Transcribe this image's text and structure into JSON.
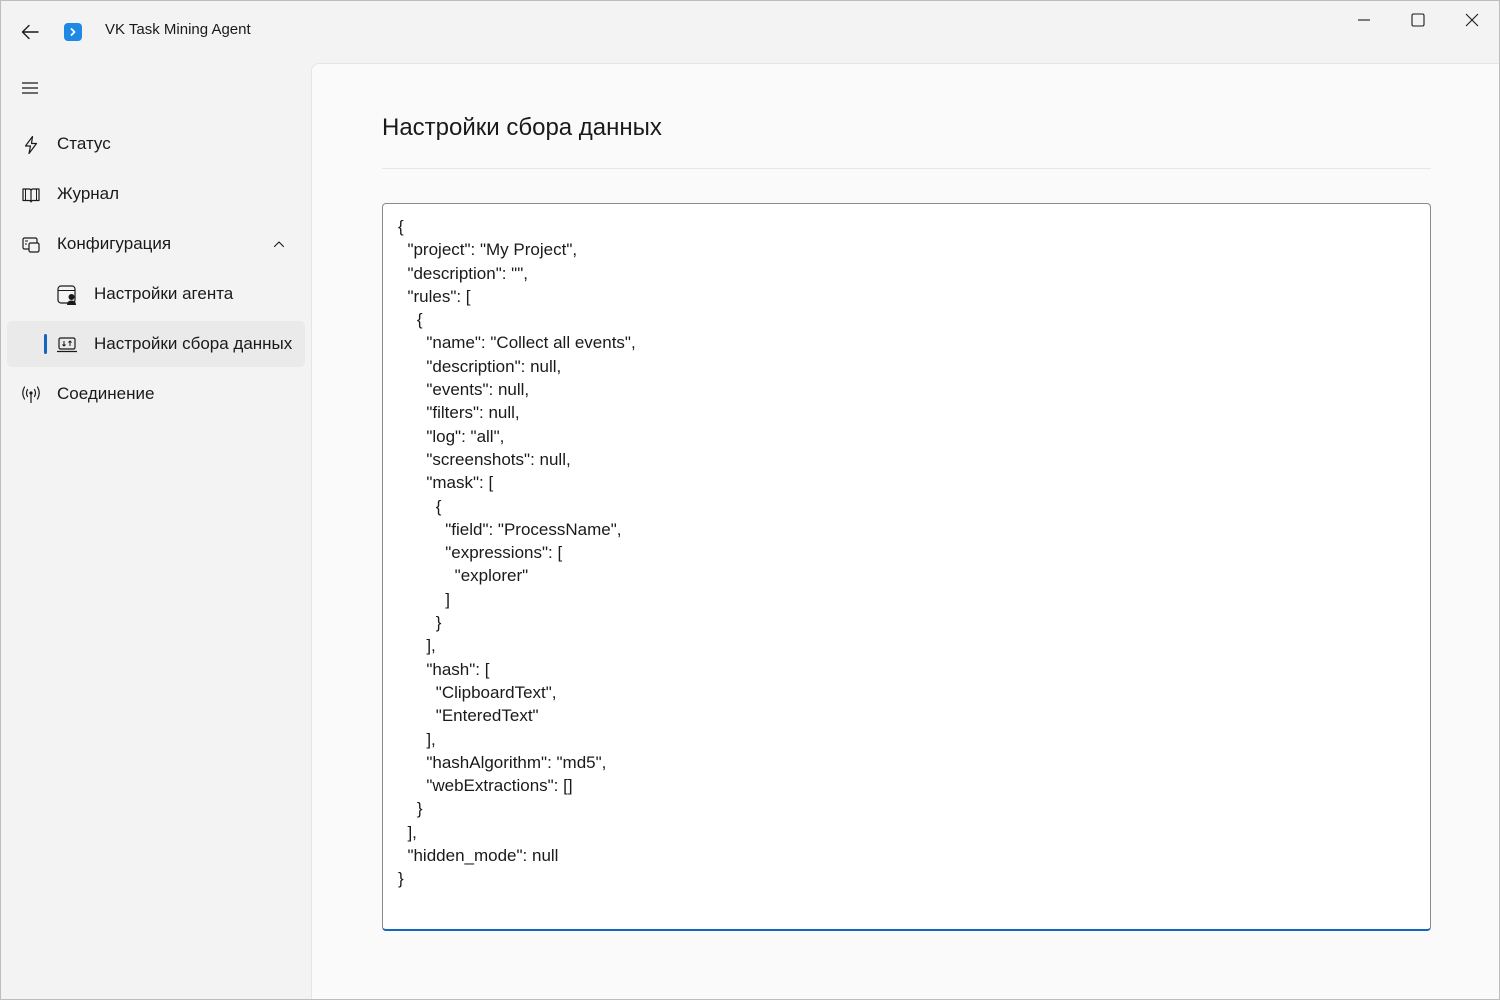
{
  "app": {
    "title": "VK Task Mining Agent",
    "accent_color": "#1565c0",
    "logo_color": "#1e88e5"
  },
  "titlebar": {
    "back_icon": "arrow-left-icon",
    "minimize_icon": "minimize-icon",
    "maximize_icon": "maximize-icon",
    "close_icon": "close-icon"
  },
  "sidebar": {
    "menu_icon": "hamburger-icon",
    "items": [
      {
        "label": "Статус",
        "icon": "lightning-icon"
      },
      {
        "label": "Журнал",
        "icon": "book-icon"
      },
      {
        "label": "Конфигурация",
        "icon": "configuration-icon",
        "expanded": true
      },
      {
        "label": "Настройки агента",
        "icon": "agent-settings-icon"
      },
      {
        "label": "Настройки сбора данных",
        "icon": "data-collection-icon",
        "selected": true
      },
      {
        "label": "Соединение",
        "icon": "antenna-icon"
      }
    ]
  },
  "main": {
    "title": "Настройки сбора данных",
    "editor_value": "{\n  \"project\": \"My Project\",\n  \"description\": \"\",\n  \"rules\": [\n    {\n      \"name\": \"Collect all events\",\n      \"description\": null,\n      \"events\": null,\n      \"filters\": null,\n      \"log\": \"all\",\n      \"screenshots\": null,\n      \"mask\": [\n        {\n          \"field\": \"ProcessName\",\n          \"expressions\": [\n            \"explorer\"\n          ]\n        }\n      ],\n      \"hash\": [\n        \"ClipboardText\",\n        \"EnteredText\"\n      ],\n      \"hashAlgorithm\": \"md5\",\n      \"webExtractions\": []\n    }\n  ],\n  \"hidden_mode\": null\n}"
  }
}
